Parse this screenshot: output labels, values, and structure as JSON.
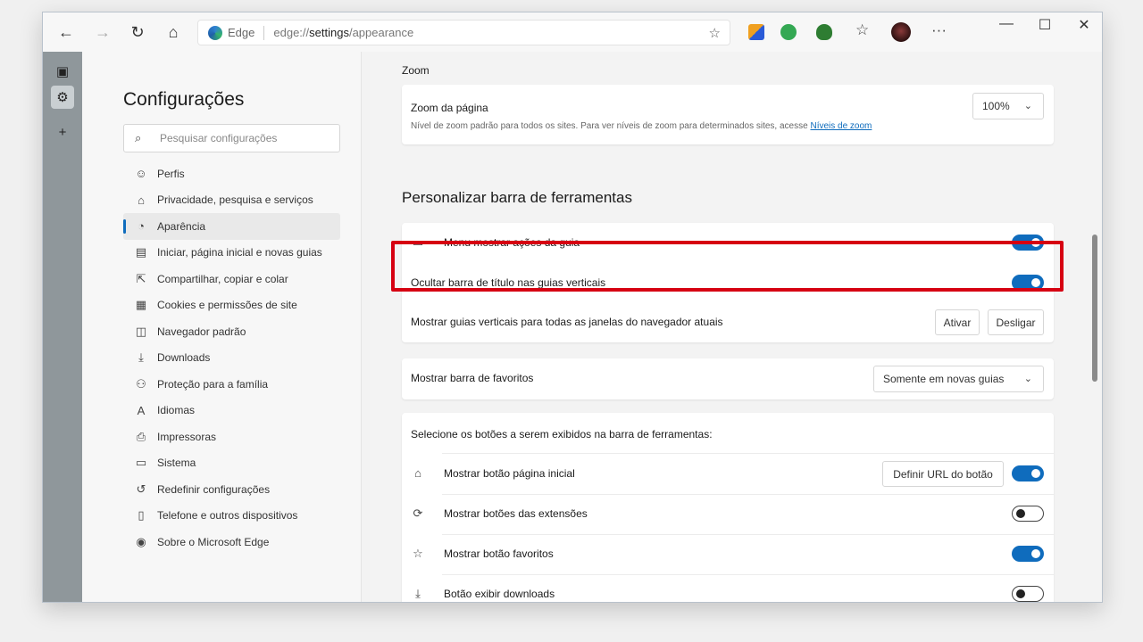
{
  "browser": {
    "site_name": "Edge",
    "url_prefix": "edge://",
    "url_path": "settings",
    "url_suffix": "/appearance",
    "back_icon": "back-arrow-icon",
    "colors": {
      "accent": "#0f6cbd",
      "highlight": "#d60012"
    }
  },
  "window_controls": {
    "minimize": "—",
    "maximize": "☐",
    "close": "✕"
  },
  "sidebar": {
    "title": "Configurações",
    "search_placeholder": "Pesquisar configurações",
    "items": [
      {
        "label": "Perfis",
        "icon": "profile-icon"
      },
      {
        "label": "Privacidade, pesquisa e serviços",
        "icon": "lock-icon"
      },
      {
        "label": "Aparência",
        "icon": "appearance-icon",
        "active": true
      },
      {
        "label": "Iniciar, página inicial e novas guias",
        "icon": "start-page-icon"
      },
      {
        "label": "Compartilhar, copiar e colar",
        "icon": "share-icon"
      },
      {
        "label": "Cookies e permissões de site",
        "icon": "cookies-icon"
      },
      {
        "label": "Navegador padrão",
        "icon": "browser-icon"
      },
      {
        "label": "Downloads",
        "icon": "download-icon"
      },
      {
        "label": "Proteção para a família",
        "icon": "family-icon"
      },
      {
        "label": "Idiomas",
        "icon": "language-icon"
      },
      {
        "label": "Impressoras",
        "icon": "printer-icon"
      },
      {
        "label": "Sistema",
        "icon": "system-icon"
      },
      {
        "label": "Redefinir configurações",
        "icon": "reset-icon"
      },
      {
        "label": "Telefone e outros dispositivos",
        "icon": "phone-icon"
      },
      {
        "label": "Sobre o Microsoft Edge",
        "icon": "edge-icon"
      }
    ]
  },
  "zoom": {
    "heading": "Zoom",
    "label": "Zoom da página",
    "description": "Nível de zoom padrão para todos os sites. Para ver níveis de zoom para determinados sites, acesse",
    "link": "Níveis de zoom",
    "value": "100%"
  },
  "toolbar_section": {
    "title": "Personalizar barra de ferramentas",
    "menu_actions": {
      "label": "Menu mostrar ações da guia",
      "on": true
    },
    "hide_titlebar": {
      "label": "Ocultar barra de título nas guias verticais",
      "on": true
    },
    "vertical_tabs": {
      "label": "Mostrar guias verticais para todas as janelas do navegador atuais",
      "activate": "Ativar",
      "deactivate": "Desligar"
    },
    "favorites_bar": {
      "label": "Mostrar barra de favoritos",
      "value": "Somente em novas guias"
    },
    "buttons_heading": "Selecione os botões a serem exibidos na barra de ferramentas:",
    "buttons": [
      {
        "label": "Mostrar botão página inicial",
        "icon": "home-icon",
        "on": true,
        "extra_button": "Definir URL do botão"
      },
      {
        "label": "Mostrar botões das extensões",
        "icon": "extensions-icon",
        "on": false
      },
      {
        "label": "Mostrar botão favoritos",
        "icon": "favorites-icon",
        "on": true
      },
      {
        "label": "Botão exibir downloads",
        "icon": "download-icon",
        "on": false
      }
    ]
  }
}
